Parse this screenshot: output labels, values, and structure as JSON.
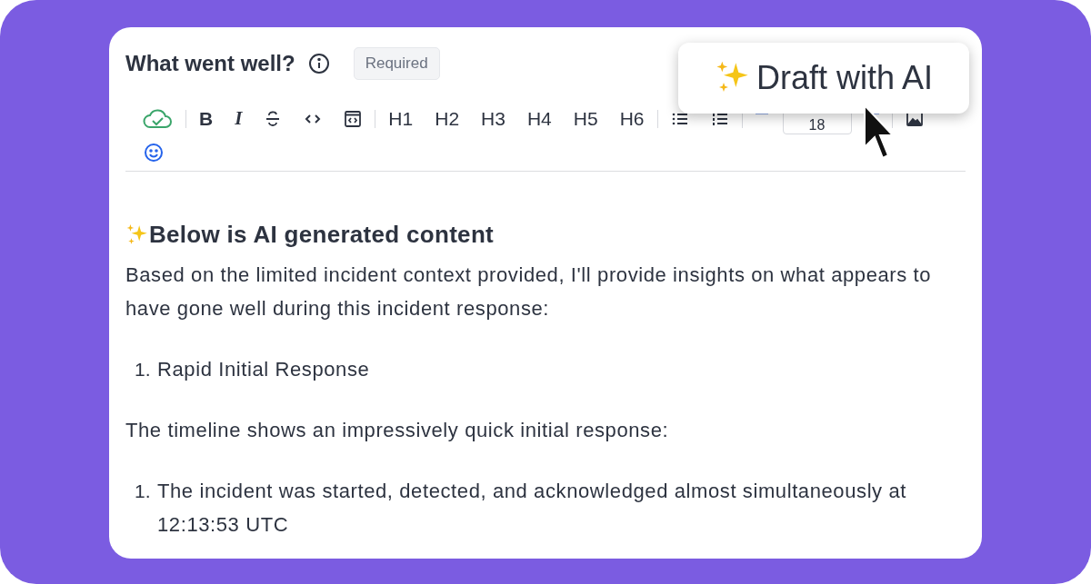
{
  "field": {
    "title": "What went well?",
    "badge": "Required"
  },
  "toolbar": [
    {
      "kind": "cloud"
    },
    {
      "kind": "divider"
    },
    {
      "kind": "bold",
      "label": "B"
    },
    {
      "kind": "italic",
      "label": "I"
    },
    {
      "kind": "strike"
    },
    {
      "kind": "code"
    },
    {
      "kind": "codeblock"
    },
    {
      "kind": "divider"
    },
    {
      "kind": "text",
      "label": "H1"
    },
    {
      "kind": "text",
      "label": "H2"
    },
    {
      "kind": "text",
      "label": "H3"
    },
    {
      "kind": "text",
      "label": "H4"
    },
    {
      "kind": "text",
      "label": "H5"
    },
    {
      "kind": "text",
      "label": "H6"
    },
    {
      "kind": "divider"
    },
    {
      "kind": "bullets"
    },
    {
      "kind": "numbers"
    },
    {
      "kind": "divider"
    },
    {
      "kind": "color"
    },
    {
      "kind": "size",
      "label": "18"
    },
    {
      "kind": "color"
    },
    {
      "kind": "divider"
    },
    {
      "kind": "image"
    },
    {
      "kind": "emoji"
    }
  ],
  "popup": {
    "label": "Draft with AI"
  },
  "content": [
    {
      "kind": "heading",
      "text": "Below is AI generated content"
    },
    {
      "kind": "paragraph",
      "text": "Based on the limited incident context provided, I'll provide insights on what appears to have gone well during this incident response:"
    },
    {
      "kind": "list",
      "items": [
        {
          "marker": "1.",
          "text": "Rapid Initial Response"
        }
      ]
    },
    {
      "kind": "paragraph",
      "text": "The timeline shows an impressively quick initial response:"
    },
    {
      "kind": "list",
      "items": [
        {
          "marker": "1.",
          "text": "The incident was started, detected, and acknowledged almost simultaneously at 12:13:53 UTC"
        }
      ]
    }
  ]
}
